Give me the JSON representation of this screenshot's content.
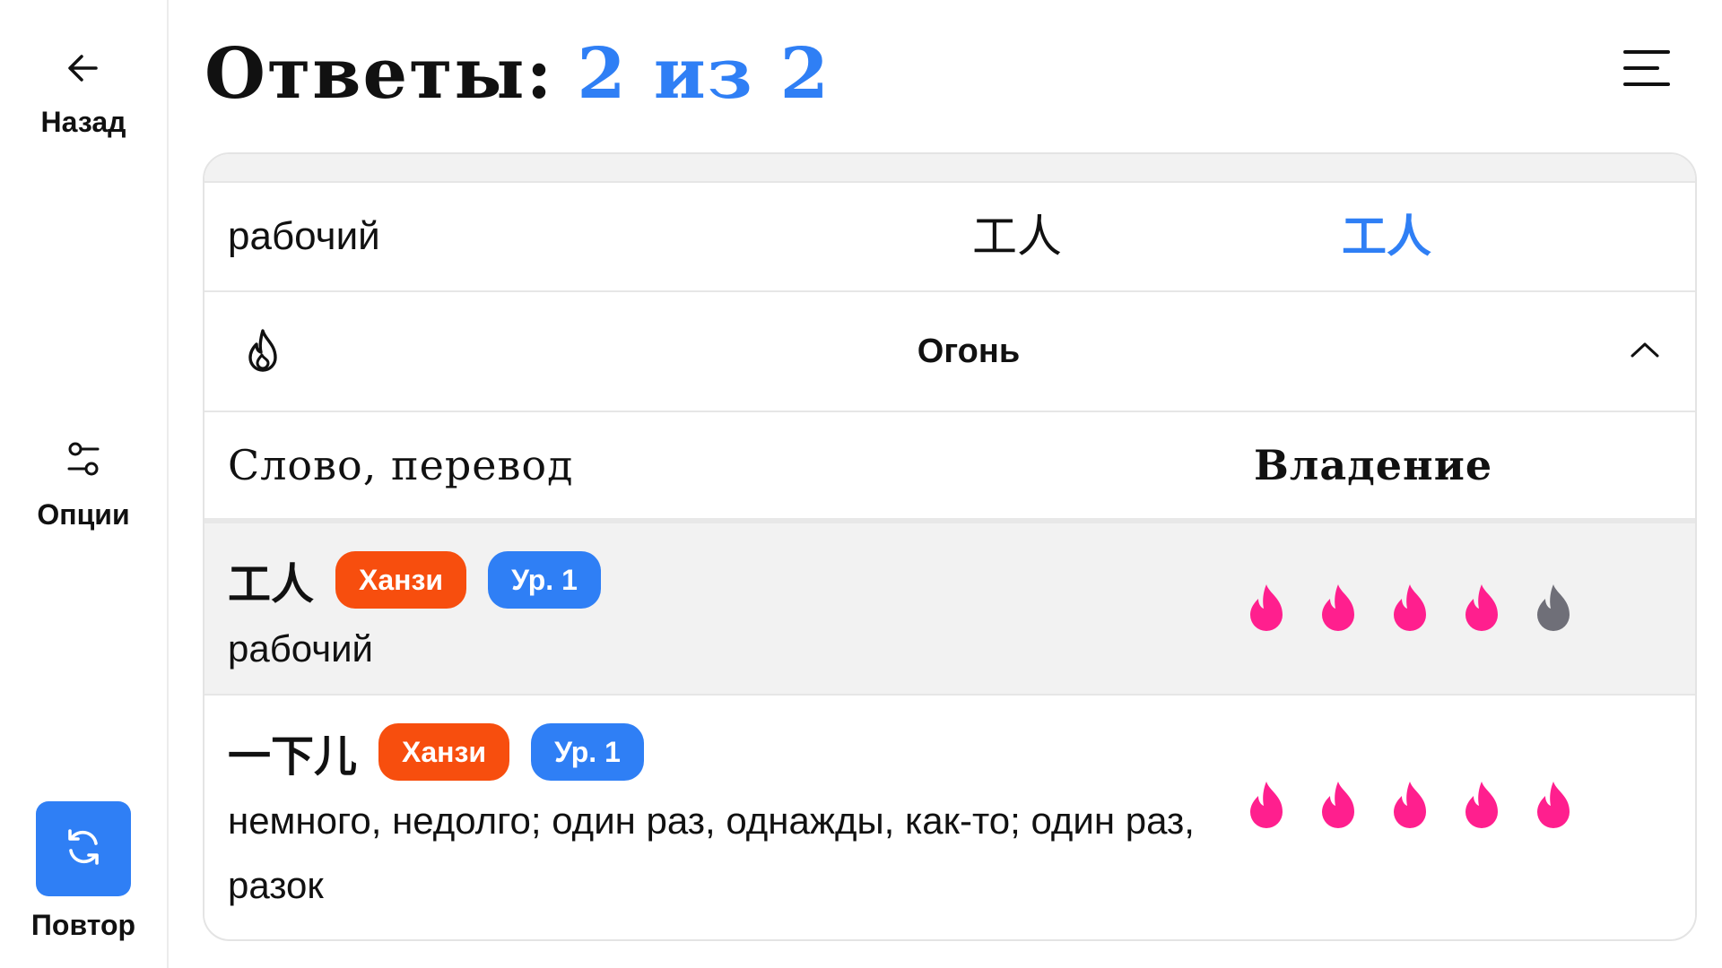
{
  "sidebar": {
    "back_label": "Назад",
    "options_label": "Опции",
    "retry_label": "Повтор",
    "icons": [
      "arrow-left-icon",
      "sliders-icon",
      "refresh-icon"
    ],
    "accent_color": "#2f7ff5"
  },
  "header": {
    "title": "Ответы:",
    "progress": "2 из 2",
    "menu_icon": "hamburger-menu-icon"
  },
  "answer": {
    "prompt": "рабочий",
    "expected": "工人",
    "given": "工人"
  },
  "accordion": {
    "title": "Огонь",
    "icon": "flame-outline-icon",
    "expanded": true
  },
  "table": {
    "col_word": "Слово, перевод",
    "col_mastery": "Владение",
    "rows": [
      {
        "hanzi": "工人",
        "type_badge": "Ханзи",
        "level_badge": "Ур. 1",
        "translation": "рабочий",
        "mastery": 4,
        "mastery_max": 5
      },
      {
        "hanzi": "一下儿",
        "type_badge": "Ханзи",
        "level_badge": "Ур. 1",
        "translation": "немного, недолго; один раз, однажды, как-то; один раз, разок",
        "mastery": 5,
        "mastery_max": 5
      }
    ]
  },
  "colors": {
    "flame_active": "#ff1f8e",
    "flame_inactive": "#6f6f78",
    "badge_type": "#f74e0e",
    "badge_level": "#2f7ff5"
  }
}
